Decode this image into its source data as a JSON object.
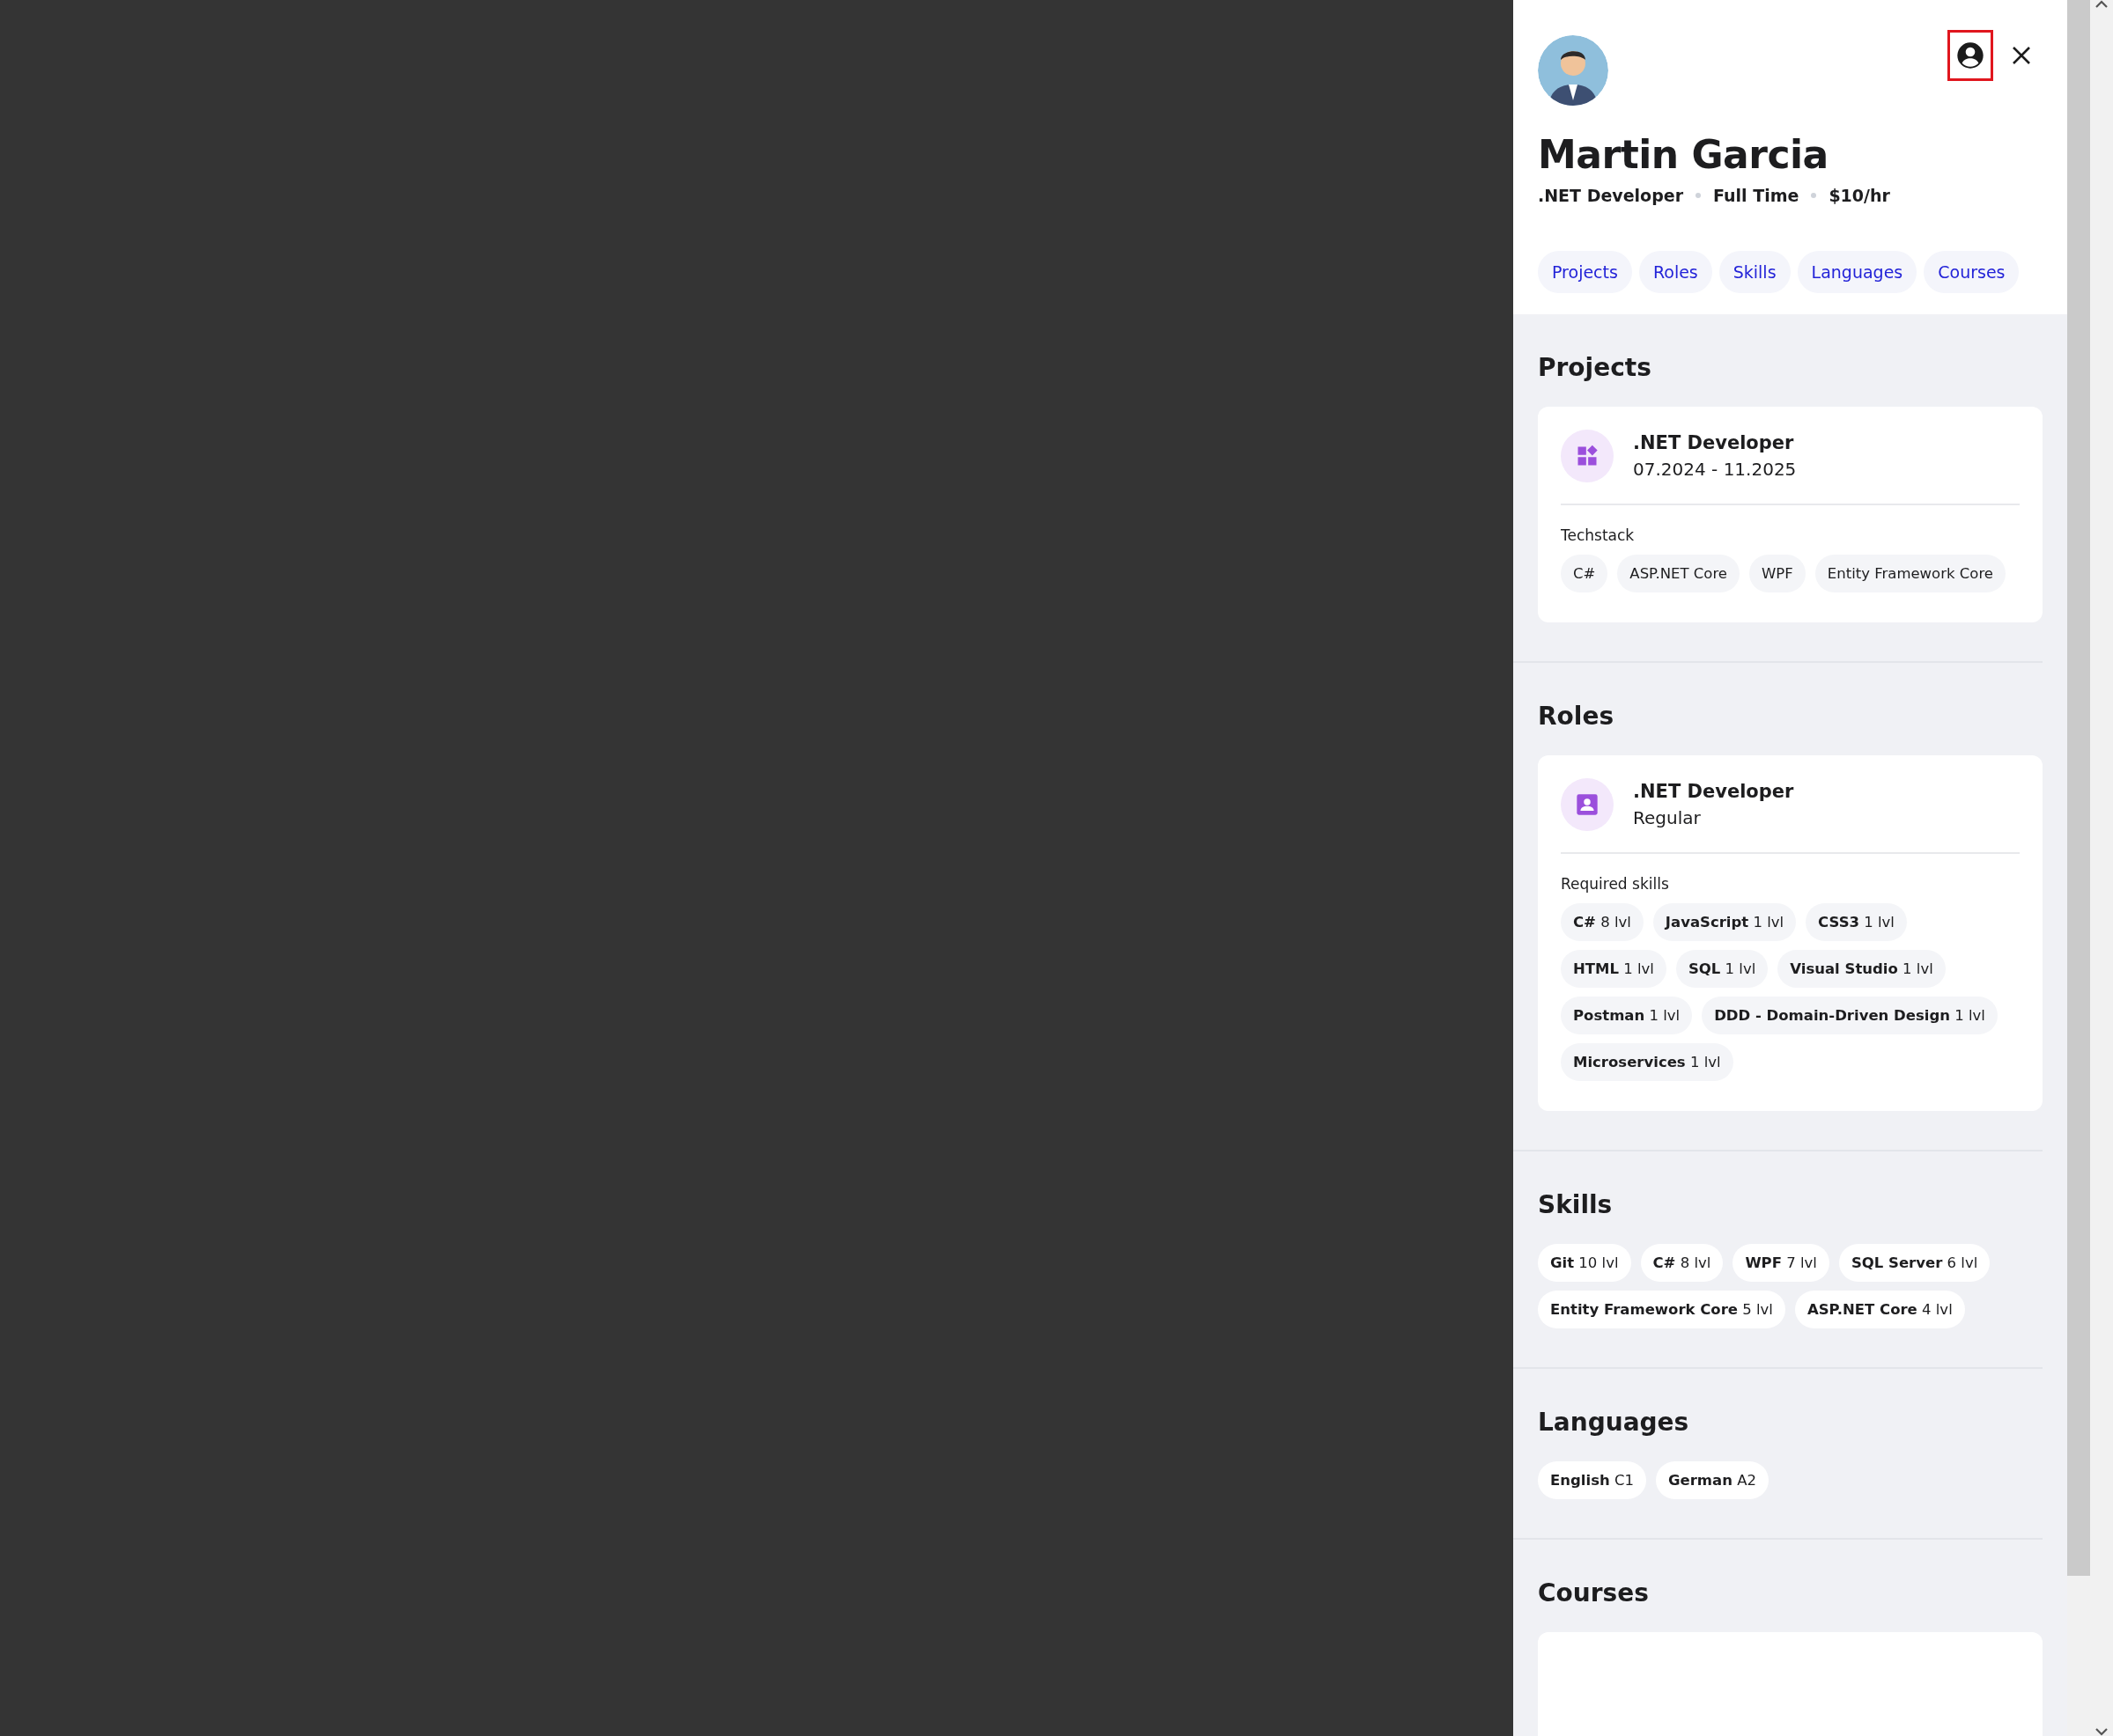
{
  "profile": {
    "name": "Martin Garcia",
    "meta": [
      ".NET Developer",
      "Full Time",
      "$10/hr"
    ],
    "profile_button": {
      "highlighted": true
    }
  },
  "nav": [
    {
      "label": "Projects"
    },
    {
      "label": "Roles"
    },
    {
      "label": "Skills"
    },
    {
      "label": "Languages"
    },
    {
      "label": "Courses"
    }
  ],
  "sections": [
    {
      "kind": "cards",
      "title": "Projects",
      "cards": [
        {
          "kind": "project",
          "title": ".NET Developer",
          "subtitle": "07.2024 - 11.2025",
          "list_label": "Techstack",
          "chips": [
            "C#",
            "ASP.NET Core",
            "WPF",
            "Entity Framework Core"
          ]
        }
      ]
    },
    {
      "kind": "cards",
      "title": "Roles",
      "cards": [
        {
          "kind": "role",
          "title": ".NET Developer",
          "subtitle": "Regular",
          "list_label": "Required skills",
          "chips": [
            "**C#** 8 lvl",
            "**JavaScript** 1 lvl",
            "**CSS3** 1 lvl",
            "**HTML** 1 lvl",
            "**SQL** 1 lvl",
            "**Visual Studio** 1 lvl",
            "**Postman** 1 lvl",
            "**DDD - Domain-Driven Design** 1 lvl",
            "**Microservices** 1 lvl"
          ]
        }
      ]
    },
    {
      "kind": "chips",
      "title": "Skills",
      "chips": [
        "**Git** 10 lvl",
        "**C#** 8 lvl",
        "**WPF** 7 lvl",
        "**SQL Server** 6 lvl",
        "**Entity Framework Core** 5 lvl",
        "**ASP.NET Core** 4 lvl"
      ]
    },
    {
      "kind": "chips",
      "title": "Languages",
      "chips": [
        "**English** C1",
        "**German** A2"
      ]
    },
    {
      "kind": "cards",
      "title": "Courses",
      "cards": [
        {
          "kind": "blank"
        }
      ]
    }
  ]
}
